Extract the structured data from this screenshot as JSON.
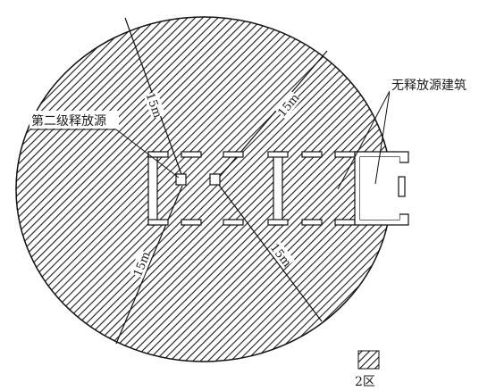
{
  "labels": {
    "second_grade_source": "第二级释放源",
    "no_source_building": "无释放源建筑",
    "distance_1": "15m",
    "distance_2": "15m",
    "distance_3": "15m",
    "distance_4": "15m"
  },
  "legend": {
    "zone_label": "2区"
  },
  "colors": {
    "hatch": "#1a1a1a",
    "outline": "#111111",
    "background": "#ffffff"
  }
}
